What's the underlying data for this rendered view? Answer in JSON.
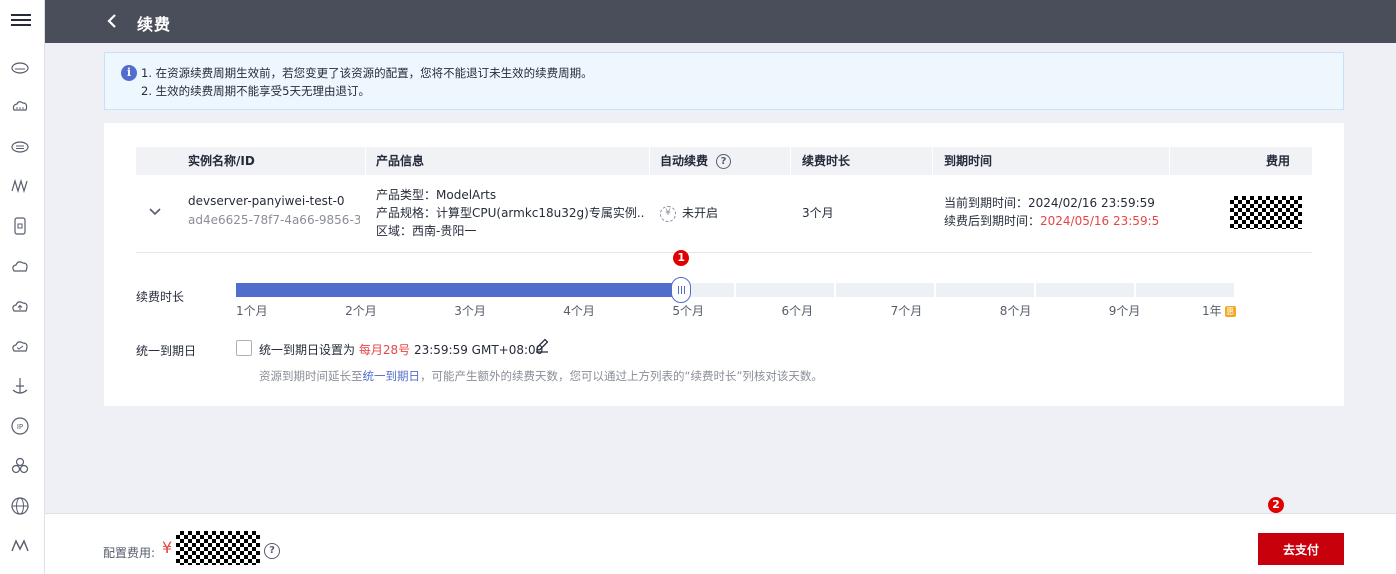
{
  "header": {
    "title": "续费"
  },
  "notice": {
    "line1": "1. 在资源续费周期生效前，若您变更了该资源的配置，您将不能退订未生效的续费周期。",
    "line2": "2. 生效的续费周期不能享受5天无理由退订。"
  },
  "table": {
    "headers": {
      "name": "实例名称/ID",
      "product": "产品信息",
      "auto": "自动续费",
      "duration": "续费时长",
      "expire": "到期时间",
      "fee": "费用"
    },
    "row": {
      "name": "devserver-panyiwei-test-0",
      "id": "ad4e6625-78f7-4a66-9856-3...",
      "product_type": "产品类型：ModelArts",
      "product_spec": "产品规格：计算型CPU(armkc18u32g)专属实例...",
      "region": "区域：西南-贵阳一",
      "auto_status": "未开启",
      "duration": "3个月",
      "current_expire_label": "当前到期时间：",
      "current_expire": "2024/02/16 23:59:59 ...",
      "new_expire_label": "续费后到期时间：",
      "new_expire": "2024/05/16 23:59:5..."
    }
  },
  "slider": {
    "label": "续费时长",
    "ticks": [
      "1个月",
      "2个月",
      "3个月",
      "4个月",
      "5个月",
      "6个月",
      "7个月",
      "8个月",
      "9个月",
      "1年"
    ],
    "selected_index": 2,
    "badge": "1"
  },
  "unify": {
    "label": "统一到期日",
    "text_prefix": "统一到期日设置为",
    "text_day": "每月28号",
    "text_suffix": "23:59:59 GMT+08:00",
    "hint_prefix": "资源到期时间延长至",
    "hint_link": "统一到期日",
    "hint_suffix": "，可能产生额外的续费天数，您可以通过上方列表的“续费时长”列核对该天数。"
  },
  "footer": {
    "label": "配置费用:",
    "currency": "¥",
    "pay_button": "去支付",
    "badge": "2"
  },
  "colors": {
    "brand_red": "#c7000b",
    "accent_blue": "#526ecc",
    "header_bg": "#4a4e5a"
  },
  "icons": [
    "menu-icon",
    "back-icon",
    "info-icon",
    "help-icon",
    "chevron-down-icon",
    "auto-renew-icon",
    "pencil-icon",
    "year-discount-icon"
  ]
}
